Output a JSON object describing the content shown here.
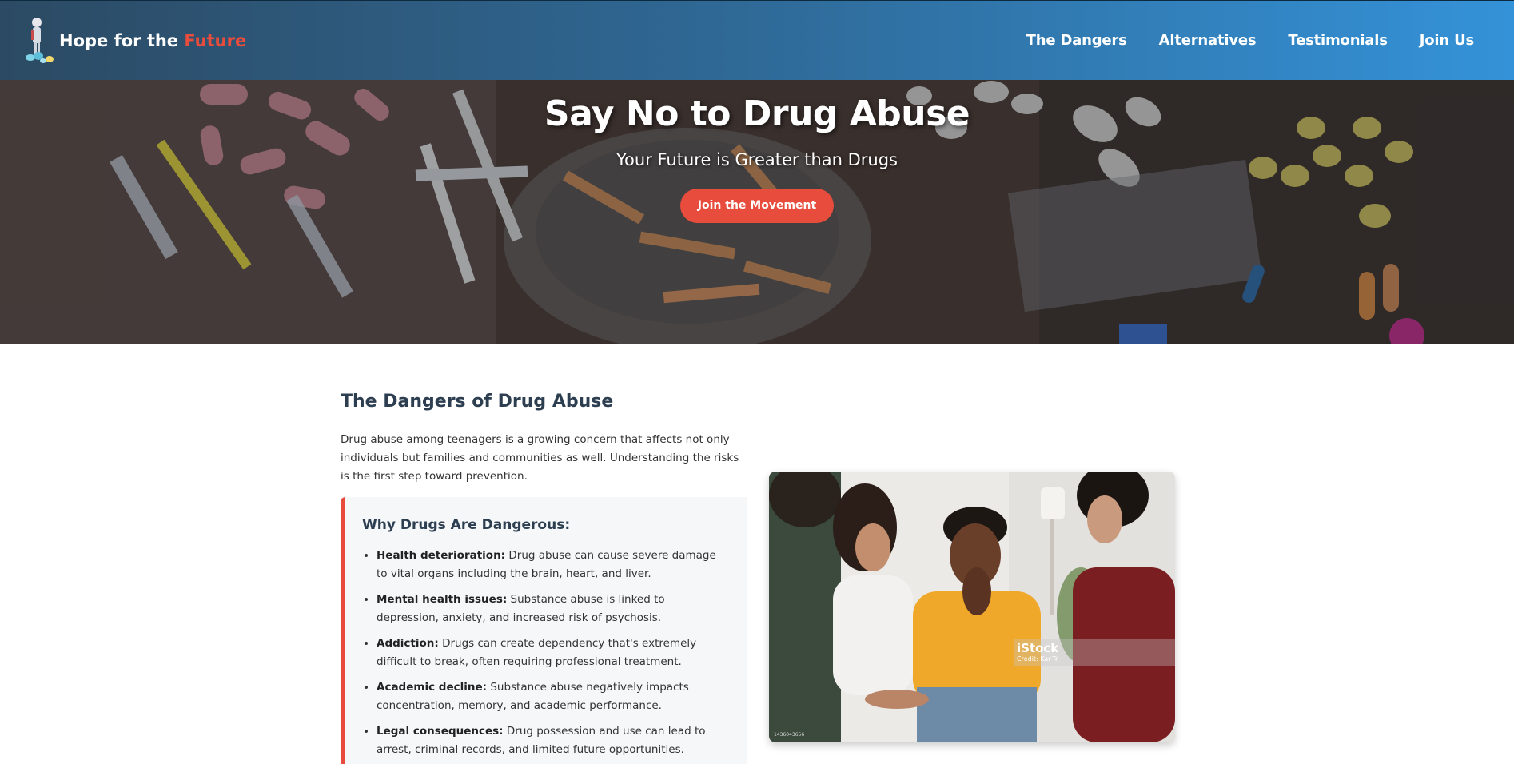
{
  "header": {
    "brand_main": "Hope for the ",
    "brand_accent": "Future",
    "logo_icon": "person-with-pills-logo",
    "nav": [
      {
        "label": "The Dangers"
      },
      {
        "label": "Alternatives"
      },
      {
        "label": "Testimonials"
      },
      {
        "label": "Join Us"
      }
    ]
  },
  "hero": {
    "title": "Say No to Drug Abuse",
    "subtitle": "Your Future is Greater than Drugs",
    "cta": "Join the Movement"
  },
  "dangers": {
    "title": "The Dangers of Drug Abuse",
    "intro": "Drug abuse among teenagers is a growing concern that affects not only individuals but families and communities as well. Understanding the risks is the first step toward prevention.",
    "box_title": "Why Drugs Are Dangerous:",
    "items": [
      {
        "term": "Health deterioration:",
        "text": " Drug abuse can cause severe damage to vital organs including the brain, heart, and liver."
      },
      {
        "term": "Mental health issues:",
        "text": " Substance abuse is linked to depression, anxiety, and increased risk of psychosis."
      },
      {
        "term": "Addiction:",
        "text": " Drugs can create dependency that's extremely difficult to break, often requiring professional treatment."
      },
      {
        "term": "Academic decline:",
        "text": " Substance abuse negatively impacts concentration, memory, and academic performance."
      },
      {
        "term": "Legal consequences:",
        "text": " Drug possession and use can lead to arrest, criminal records, and limited future opportunities."
      }
    ],
    "photo": {
      "watermark": "iStock",
      "credit": "Credit: Kar-Tr",
      "stock_id": "1436043656"
    }
  },
  "colors": {
    "accent": "#e74c3c",
    "heading": "#2c3e50",
    "header_start": "#2c4a63",
    "header_end": "#3492d8"
  }
}
